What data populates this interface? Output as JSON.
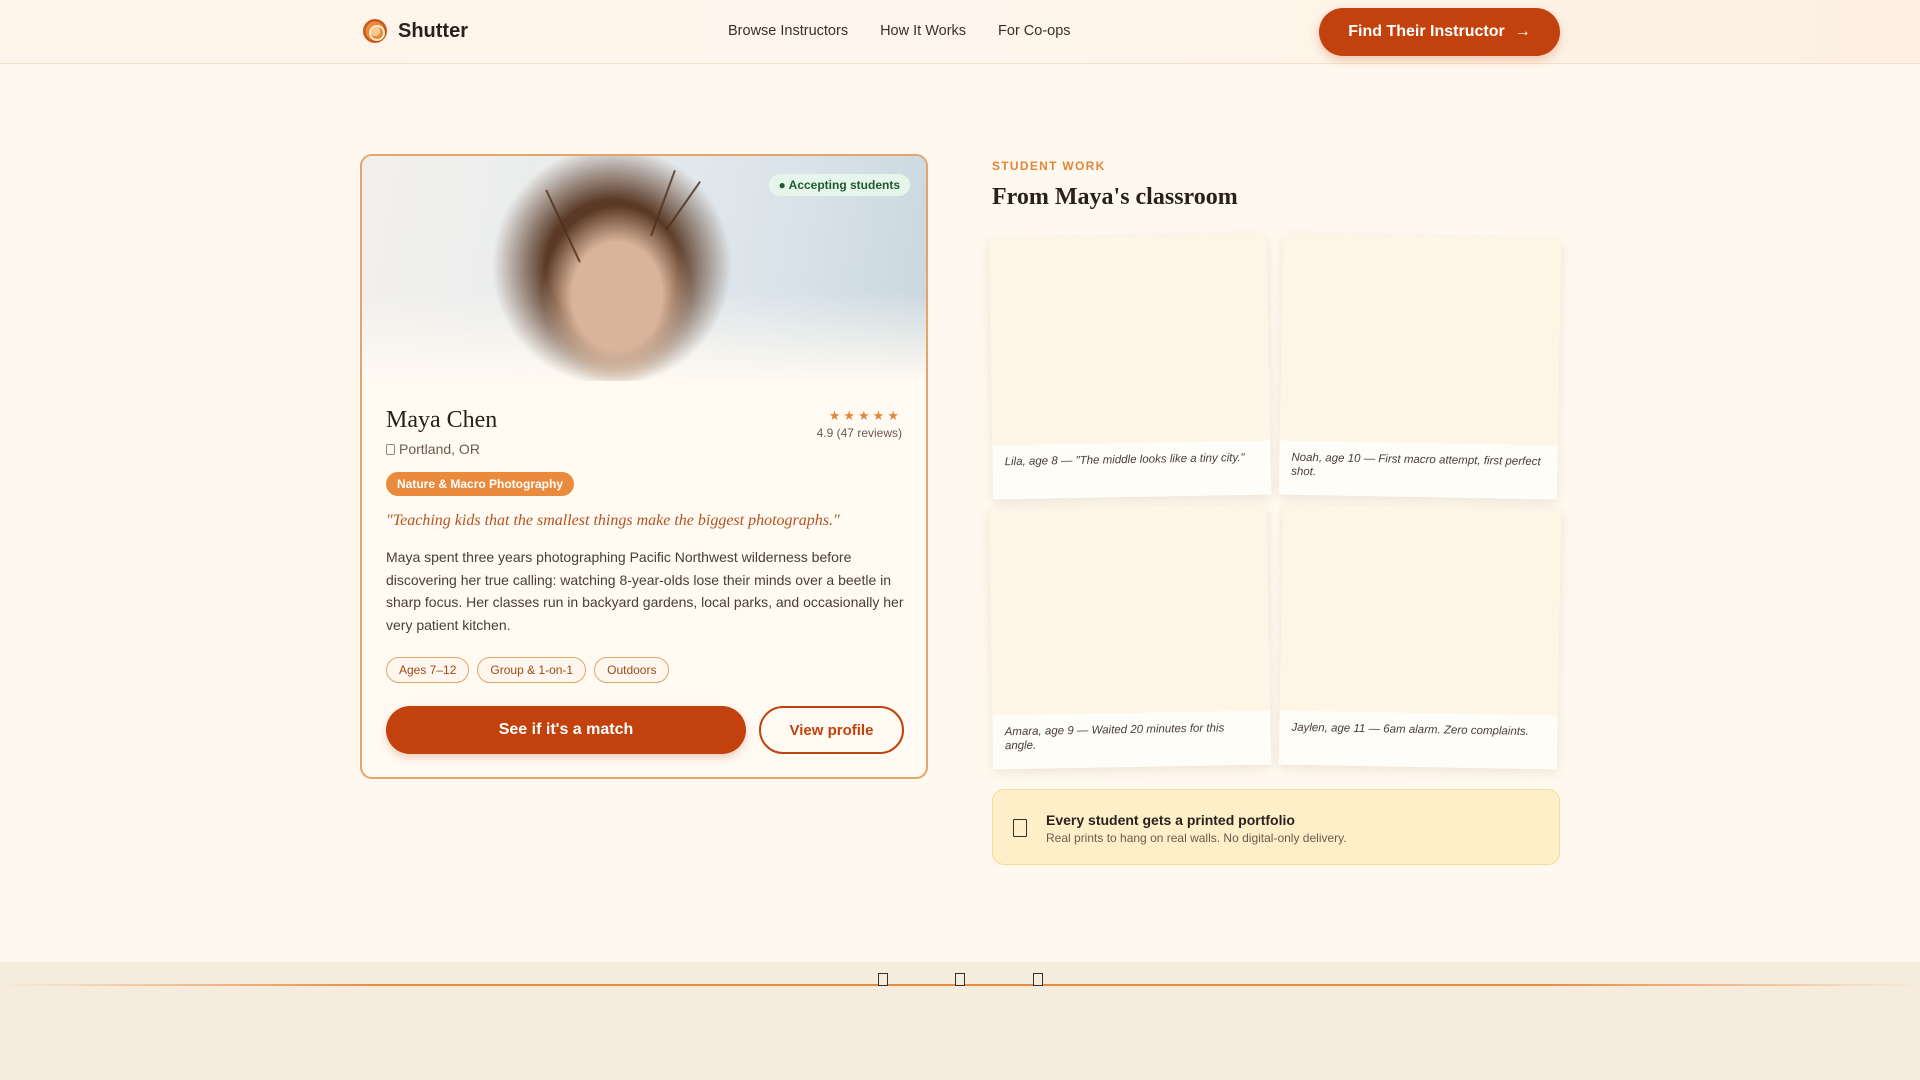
{
  "header": {
    "logo_text": "Shutter",
    "nav": [
      "Browse Instructors",
      "How It Works",
      "For Co-ops"
    ],
    "cta_label": "Find Their Instructor"
  },
  "instructor": {
    "status_badge": "● Accepting students",
    "name": "Maya Chen",
    "location": "Portland, OR",
    "stars": "★★★★★",
    "rating": "4.9 (47 reviews)",
    "specialty": "Nature & Macro Photography",
    "quote": "\"Teaching kids that the smallest things make the biggest photographs.\"",
    "bio": "Maya spent three years photographing Pacific Northwest wilderness before discovering her true calling: watching 8-year-olds lose their minds over a beetle in sharp focus. Her classes run in backyard gardens, local parks, and occasionally her very patient kitchen.",
    "tags": [
      "Ages 7–12",
      "Group & 1-on-1",
      "Outdoors"
    ],
    "primary_button": "See if it's a match",
    "secondary_button": "View profile"
  },
  "student_work": {
    "eyebrow": "STUDENT WORK",
    "title": "From Maya's classroom",
    "items": [
      {
        "caption": "Lila, age 8 — \"The middle looks like a tiny city.\""
      },
      {
        "caption": "Noah, age 10 — First macro attempt, first perfect shot."
      },
      {
        "caption": "Amara, age 9 — Waited 20 minutes for this angle."
      },
      {
        "caption": "Jaylen, age 11 — 6am alarm. Zero complaints."
      }
    ]
  },
  "portfolio": {
    "title": "Every student gets a printed portfolio",
    "subtitle": "Real prints to hang on real walls. No digital-only delivery."
  },
  "colors": {
    "accent": "#c2410c",
    "accent_light": "#ea8a3c",
    "background": "#fef8ee",
    "status_green": "#1d5a32"
  },
  "icons": [
    "logo-mark-icon",
    "arrow-right-icon",
    "pin-icon",
    "star-icon",
    "print-icon"
  ]
}
